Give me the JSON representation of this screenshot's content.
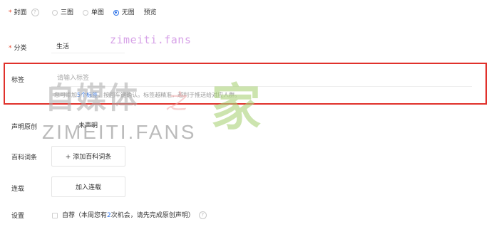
{
  "cover": {
    "label": "封面",
    "options": [
      {
        "label": "三图",
        "selected": false
      },
      {
        "label": "单图",
        "selected": false
      },
      {
        "label": "无图",
        "selected": true
      }
    ],
    "preview_label": "预览"
  },
  "category": {
    "label": "分类",
    "value": "生活"
  },
  "tags": {
    "label": "标签",
    "placeholder": "请输入标签",
    "hint_prefix": "您可添加",
    "hint_count": "5个标签",
    "hint_suffix": "，按回车键确认。标签越精准，越利于推送给对应人群。"
  },
  "original": {
    "label": "声明原创",
    "value": "未声明"
  },
  "baike": {
    "label": "百科词条",
    "button": "+ 添加百科词条"
  },
  "serial": {
    "label": "连载",
    "button": "加入连载"
  },
  "settings": {
    "label": "设置",
    "option_prefix": "自荐（本周您有",
    "option_count": "2",
    "option_suffix": "次机会，请先完成原创声明）"
  },
  "watermark": {
    "top_text": "zimeiti.fans",
    "big_chars": "自媒体",
    "zhi": "之",
    "jia": "家",
    "fans": "ZIMEITI.FANS"
  },
  "colors": {
    "accent": "#2f74e8",
    "required": "#e8472c",
    "highlight_frame": "#e0312b"
  }
}
